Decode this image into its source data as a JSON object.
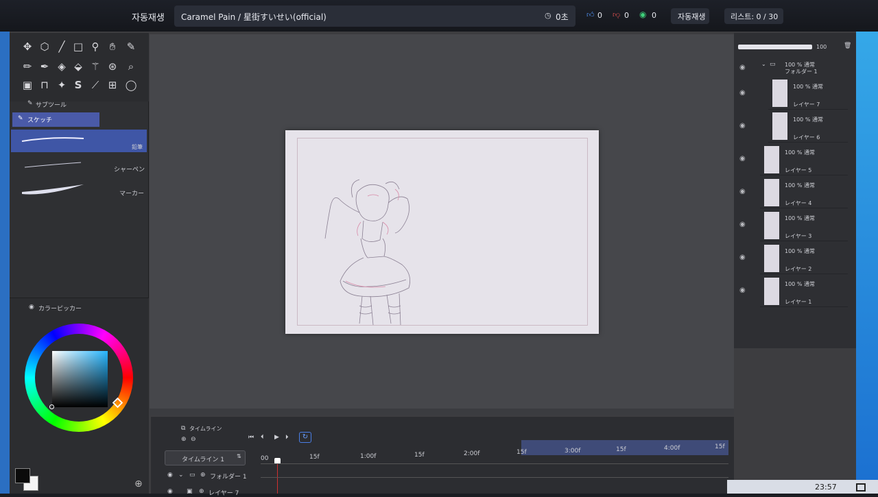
{
  "topbar": {
    "autoplay_left": "자동재생",
    "track_title": "Caramel Pain / 星街すいせい(official)",
    "timer": "0초",
    "likes": "0",
    "dislikes": "0",
    "views": "0",
    "autoplay_button": "자동재생",
    "list_status": "리스트: 0 / 30"
  },
  "tools": {
    "subtool_header": "サブツール",
    "active_group": "スケッチ",
    "brushes": [
      {
        "label": "鉛筆"
      },
      {
        "label": "シャーペン"
      },
      {
        "label": "マーカー"
      }
    ]
  },
  "colorpicker": {
    "header": "カラーピッカー",
    "main_color": "#0b0b0b",
    "sub_color": "#f4f4f4"
  },
  "layers": {
    "opacity": "100",
    "folder": {
      "blend": "100 % 通常",
      "name": "フォルダー 1"
    },
    "items": [
      {
        "blend": "100 % 通常",
        "name": "レイヤー 7"
      },
      {
        "blend": "100 % 通常",
        "name": "レイヤー 6"
      },
      {
        "blend": "100 % 通常",
        "name": "レイヤー 5"
      },
      {
        "blend": "100 % 通常",
        "name": "レイヤー 4"
      },
      {
        "blend": "100 % 通常",
        "name": "レイヤー 3"
      },
      {
        "blend": "100 % 通常",
        "name": "レイヤー 2"
      },
      {
        "blend": "100 % 通常",
        "name": "レイヤー 1"
      }
    ]
  },
  "timeline": {
    "header": "タイムライン",
    "name": "タイムライン 1",
    "ruler": [
      "00",
      "15f",
      "1:00f",
      "15f",
      "2:00f",
      "15f",
      "3:00f",
      "15f",
      "4:00f",
      "15f"
    ],
    "tracks": [
      "フォルダー 1",
      "レイヤー 7"
    ]
  },
  "system": {
    "clock": "23:57"
  },
  "colors": {
    "accent": "#4a5aa8",
    "selection": "#3f56a6"
  }
}
